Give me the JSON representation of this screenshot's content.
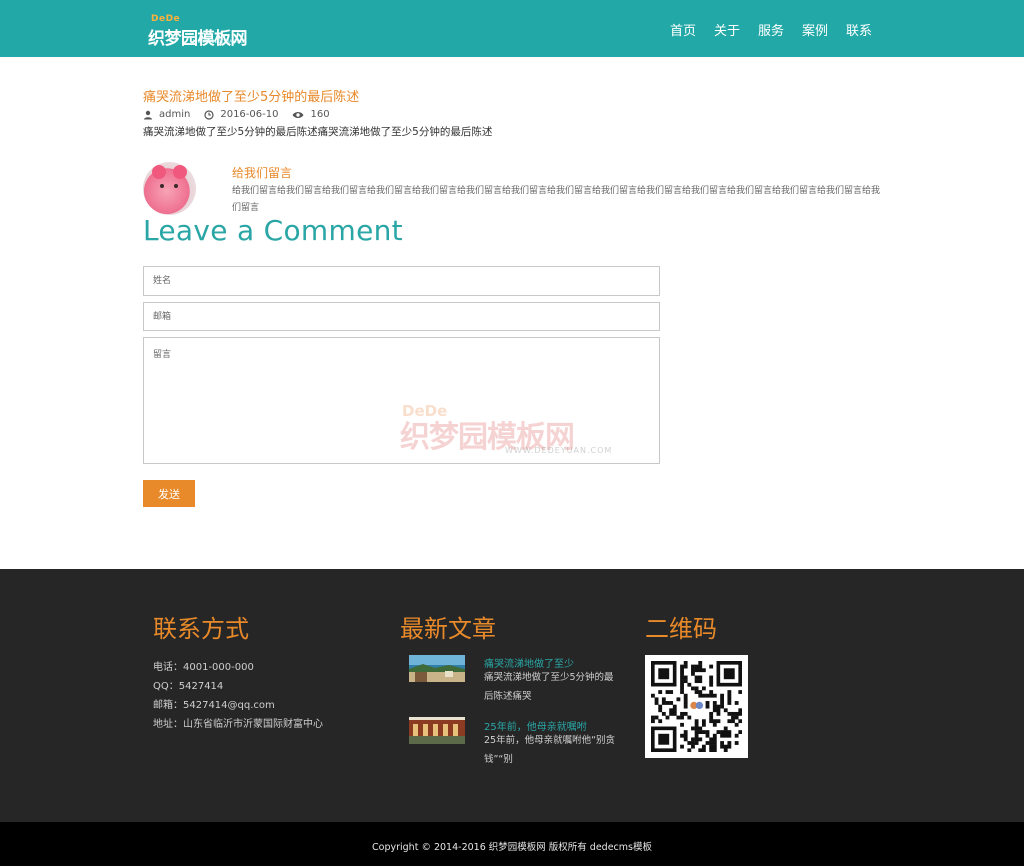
{
  "header": {
    "logo": {
      "small": "DeDe",
      "main": "织梦园模板网",
      "sub": "WWW.DEDEYUAN.COM"
    },
    "nav": [
      "首页",
      "关于",
      "服务",
      "案例",
      "联系"
    ]
  },
  "article": {
    "title": "痛哭流涕地做了至少5分钟的最后陈述",
    "author": "admin",
    "date": "2016-06-10",
    "views": "160",
    "body": "痛哭流涕地做了至少5分钟的最后陈述痛哭流涕地做了至少5分钟的最后陈述"
  },
  "comment": {
    "author": "给我们留言",
    "text": "给我们留言给我们留言给我们留言给我们留言给我们留言给我们留言给我们留言给我们留言给我们留言给我们留言给我们留言给我们留言给我们留言给我们留言给我们留言"
  },
  "form": {
    "title": "Leave a Comment",
    "name_placeholder": "姓名",
    "email_placeholder": "邮箱",
    "message_placeholder": "留言",
    "send_label": "发送"
  },
  "watermark": {
    "small": "DeDe",
    "main": "织梦园模板网",
    "url": "WWW.DEDEYUAN.COM"
  },
  "footer": {
    "contact": {
      "heading": "联系方式",
      "phone": "电话：4001-000-000",
      "qq": "QQ：5427414",
      "email": "邮箱：5427414@qq.com",
      "address": "地址：山东省临沂市沂蒙国际财富中心"
    },
    "news": {
      "heading": "最新文章",
      "items": [
        {
          "title": "痛哭流涕地做了至少",
          "desc": "痛哭流涕地做了至少5分钟的最后陈述痛哭"
        },
        {
          "title": "25年前，他母亲就嘱咐",
          "desc": "25年前，他母亲就嘱咐他“别贪钱”“别"
        }
      ]
    },
    "qr": {
      "heading": "二维码"
    },
    "copyright": "Copyright © 2014-2016 织梦园模板网 版权所有   dedecms模板"
  },
  "colors": {
    "header_bg": "#23a8a8",
    "accent_orange": "#e8892a",
    "accent_teal": "#2aa6a6",
    "footer_bg": "#262626",
    "copyright_bg": "#000000"
  }
}
